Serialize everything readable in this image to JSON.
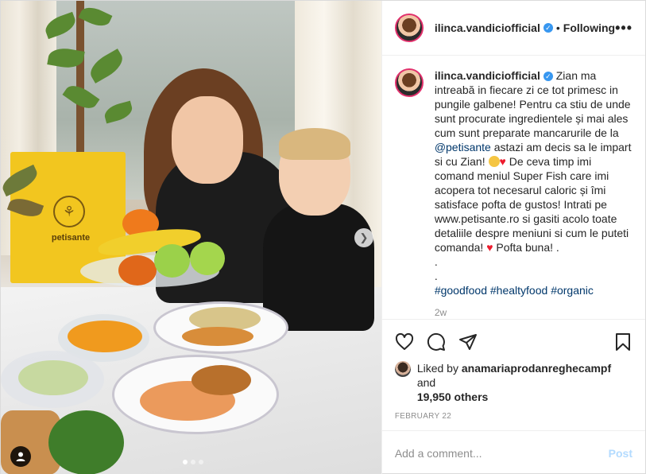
{
  "header": {
    "username": "ilinca.vandiciofficial",
    "separator": "•",
    "follow_status": "Following",
    "more": "•••"
  },
  "photo": {
    "bag_brand": "petisante",
    "carousel_dots": 3,
    "carousel_active": 1
  },
  "caption": {
    "username": "ilinca.vandiciofficial",
    "text1": "Zian ma intreabă in fiecare zi ce tot primesc in pungile galbene! Pentru ca stiu de unde sunt procurate ingredientele și mai ales cum sunt preparate mancarurile de la ",
    "mention": "@petisante",
    "text2": " astazi am decis sa le impart si cu Zian! ",
    "text3": " De ceva timp imi comand meniul Super Fish care imi acopera tot necesarul caloric și îmi satisface pofta de gustos! Intrati pe www.petisante.ro si gasiti acolo toate detaliile despre meniuni si cum le puteti comanda! ",
    "text4": " Pofta buna! .",
    "dot1": ".",
    "dot2": ".",
    "tags": [
      "#goodfood",
      "#healtyfood",
      "#organic"
    ],
    "heart": "♥",
    "time_ago": "2w"
  },
  "likes": {
    "prefix": "Liked by ",
    "user": "anamariaprodanreghecampf",
    "middle": " and",
    "count": "19,950 others"
  },
  "date": "FEBRUARY 22",
  "comment_box": {
    "placeholder": "Add a comment...",
    "post_label": "Post"
  },
  "colors": {
    "verified": "#3897f0",
    "link": "#00376b",
    "heart": "#ed1c2e",
    "post_disabled": "#b3dbff"
  }
}
